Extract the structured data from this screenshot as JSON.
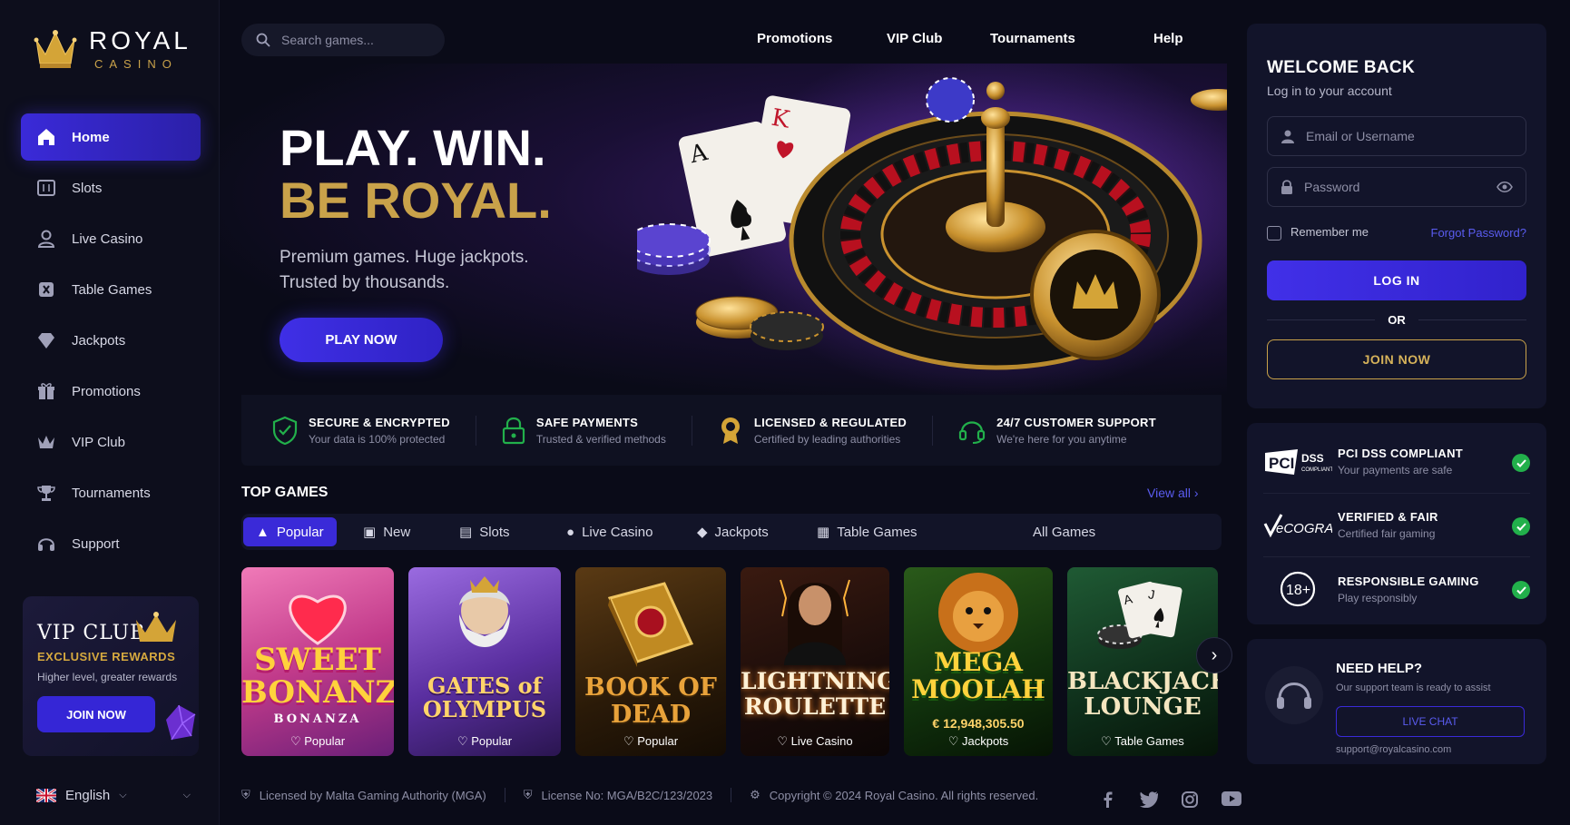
{
  "brand": {
    "name": "ROYAL",
    "sub": "CASINO"
  },
  "sidebar": {
    "items": [
      {
        "label": "Home",
        "icon": "home-icon",
        "active": true
      },
      {
        "label": "Slots",
        "icon": "slots-icon"
      },
      {
        "label": "Live Casino",
        "icon": "user-icon"
      },
      {
        "label": "Table Games",
        "icon": "cards-icon"
      },
      {
        "label": "Jackpots",
        "icon": "diamond-icon"
      },
      {
        "label": "Promotions",
        "icon": "gift-icon"
      },
      {
        "label": "VIP Club",
        "icon": "crown-icon"
      },
      {
        "label": "Tournaments",
        "icon": "trophy-icon"
      },
      {
        "label": "Support",
        "icon": "headset-icon"
      }
    ],
    "vip": {
      "title": "VIP CLUB",
      "exclusive": "EXCLUSIVE REWARDS",
      "subtitle": "Higher level, greater rewards",
      "button": "JOIN NOW"
    },
    "language": "English"
  },
  "header": {
    "search_placeholder": "Search games...",
    "nav": [
      "Promotions",
      "VIP Club",
      "Tournaments",
      "Help"
    ]
  },
  "hero": {
    "line1": "PLAY. WIN.",
    "line2": "BE ROYAL.",
    "text": "Premium games. Huge jackpots. Trusted by thousands.",
    "button": "PLAY NOW"
  },
  "features": [
    {
      "title": "SECURE & ENCRYPTED",
      "sub": "Your data is 100% protected",
      "icon": "shield-icon"
    },
    {
      "title": "SAFE PAYMENTS",
      "sub": "Trusted & verified methods",
      "icon": "lock-icon"
    },
    {
      "title": "LICENSED & REGULATED",
      "sub": "Certified by leading authorities",
      "icon": "badge-icon"
    },
    {
      "title": "24/7 CUSTOMER SUPPORT",
      "sub": "We're here for you anytime",
      "icon": "headset-icon"
    }
  ],
  "top_games": {
    "title": "TOP GAMES",
    "view_all": "View all",
    "tabs": [
      "Popular",
      "New",
      "Slots",
      "Live Casino",
      "Jackpots",
      "Table Games",
      "All Games"
    ],
    "games": [
      {
        "title": "SWEET BONANZA",
        "sub": "BONANZA",
        "tag": "Popular"
      },
      {
        "title": "GATES of OLYMPUS",
        "tag": "Popular"
      },
      {
        "title": "BOOK OF DEAD",
        "tag": "Popular"
      },
      {
        "title": "LIGHTNING ROULETTE",
        "tag": "Live Casino"
      },
      {
        "title": "MEGA MOOLAH",
        "jackpot": "€ 12,948,305.50",
        "tag": "Jackpots"
      },
      {
        "title": "BLACKJACK LOUNGE",
        "tag": "Table Games"
      }
    ]
  },
  "footer": {
    "license": "Licensed by Malta Gaming Authority (MGA)",
    "license_no": "License No: MGA/B2C/123/2023",
    "copyright": "Copyright © 2024 Royal Casino. All rights reserved."
  },
  "login": {
    "title": "WELCOME BACK",
    "subtitle": "Log in to your account",
    "email_placeholder": "Email or Username",
    "password_placeholder": "Password",
    "remember": "Remember me",
    "forgot": "Forgot Password?",
    "login_button": "LOG IN",
    "or": "OR",
    "join_button": "JOIN NOW"
  },
  "trust": [
    {
      "title": "PCI DSS COMPLIANT",
      "sub": "Your payments are safe",
      "logo": "PCI DSS"
    },
    {
      "title": "VERIFIED & FAIR",
      "sub": "Certified fair gaming",
      "logo": "eCOGRA"
    },
    {
      "title": "RESPONSIBLE GAMING",
      "sub": "Play responsibly",
      "logo": "18+"
    }
  ],
  "help": {
    "title": "NEED HELP?",
    "subtitle": "Our support team is ready to assist",
    "button": "LIVE CHAT",
    "email": "support@royalcasino.com"
  },
  "colors": {
    "accent": "#3a2ad8",
    "gold": "#c9a24a",
    "success": "#22b04b",
    "bg": "#0a0b18"
  }
}
